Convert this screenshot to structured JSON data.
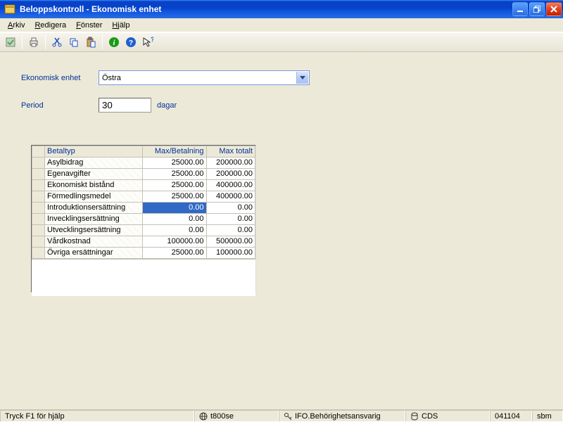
{
  "window": {
    "title": "Beloppskontroll - Ekonomisk enhet"
  },
  "menu": {
    "arkiv": "Arkiv",
    "redigera": "Redigera",
    "fonster": "Fönster",
    "hjalp": "Hjälp"
  },
  "form": {
    "ekonomisk_enhet_label": "Ekonomisk enhet",
    "ekonomisk_enhet_value": "Östra",
    "period_label": "Period",
    "period_value": "30",
    "period_unit": "dagar"
  },
  "table": {
    "headers": {
      "col1": "Betaltyp",
      "col2": "Max/Betalning",
      "col3": "Max totalt"
    },
    "rows": [
      {
        "name": "Asylbidrag",
        "maxbet": "25000.00",
        "maxtot": "200000.00"
      },
      {
        "name": "Egenavgifter",
        "maxbet": "25000.00",
        "maxtot": "200000.00"
      },
      {
        "name": "Ekonomiskt bistånd",
        "maxbet": "25000.00",
        "maxtot": "400000.00"
      },
      {
        "name": "Förmedlingsmedel",
        "maxbet": "25000.00",
        "maxtot": "400000.00"
      },
      {
        "name": "Introduktionsersättning",
        "maxbet": "0.00",
        "maxtot": "0.00",
        "selected": true
      },
      {
        "name": "Invecklingsersättning",
        "maxbet": "0.00",
        "maxtot": "0.00"
      },
      {
        "name": "Utvecklingsersättning",
        "maxbet": "0.00",
        "maxtot": "0.00"
      },
      {
        "name": "Vårdkostnad",
        "maxbet": "100000.00",
        "maxtot": "500000.00"
      },
      {
        "name": "Övriga ersättningar",
        "maxbet": "25000.00",
        "maxtot": "100000.00"
      }
    ]
  },
  "status": {
    "help": "Tryck F1 för hjälp",
    "server": "t800se",
    "role": "IFO.Behörighetsansvarig",
    "db": "CDS",
    "date": "041104",
    "user": "sbm"
  }
}
